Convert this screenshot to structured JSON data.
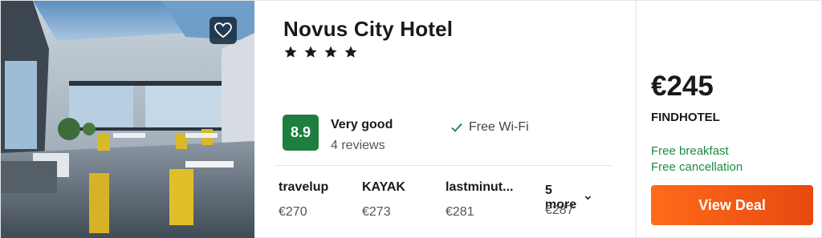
{
  "hotel": {
    "name": "Novus City Hotel",
    "star_count": 4,
    "star_glyph": "★"
  },
  "favorite": {
    "icon": "heart-icon"
  },
  "rating": {
    "score": "8.9",
    "label": "Very good",
    "reviews": "4 reviews"
  },
  "amenity": {
    "icon": "check-icon",
    "label": "Free Wi-Fi"
  },
  "providers": [
    {
      "name": "travelup",
      "price": "€270"
    },
    {
      "name": "KAYAK",
      "price": "€273"
    },
    {
      "name": "lastminut...",
      "price": "€281"
    }
  ],
  "more": {
    "label": "5 more",
    "icon": "chevron-down-icon",
    "price": "€287"
  },
  "deal": {
    "price": "€245",
    "provider": "FINDHOTEL",
    "perks": [
      "Free breakfast",
      "Free cancellation"
    ],
    "button_label": "View Deal"
  },
  "colors": {
    "rating_badge": "#1e7e3f",
    "perk_text": "#1e8a46",
    "deal_button": "#f05a14"
  }
}
